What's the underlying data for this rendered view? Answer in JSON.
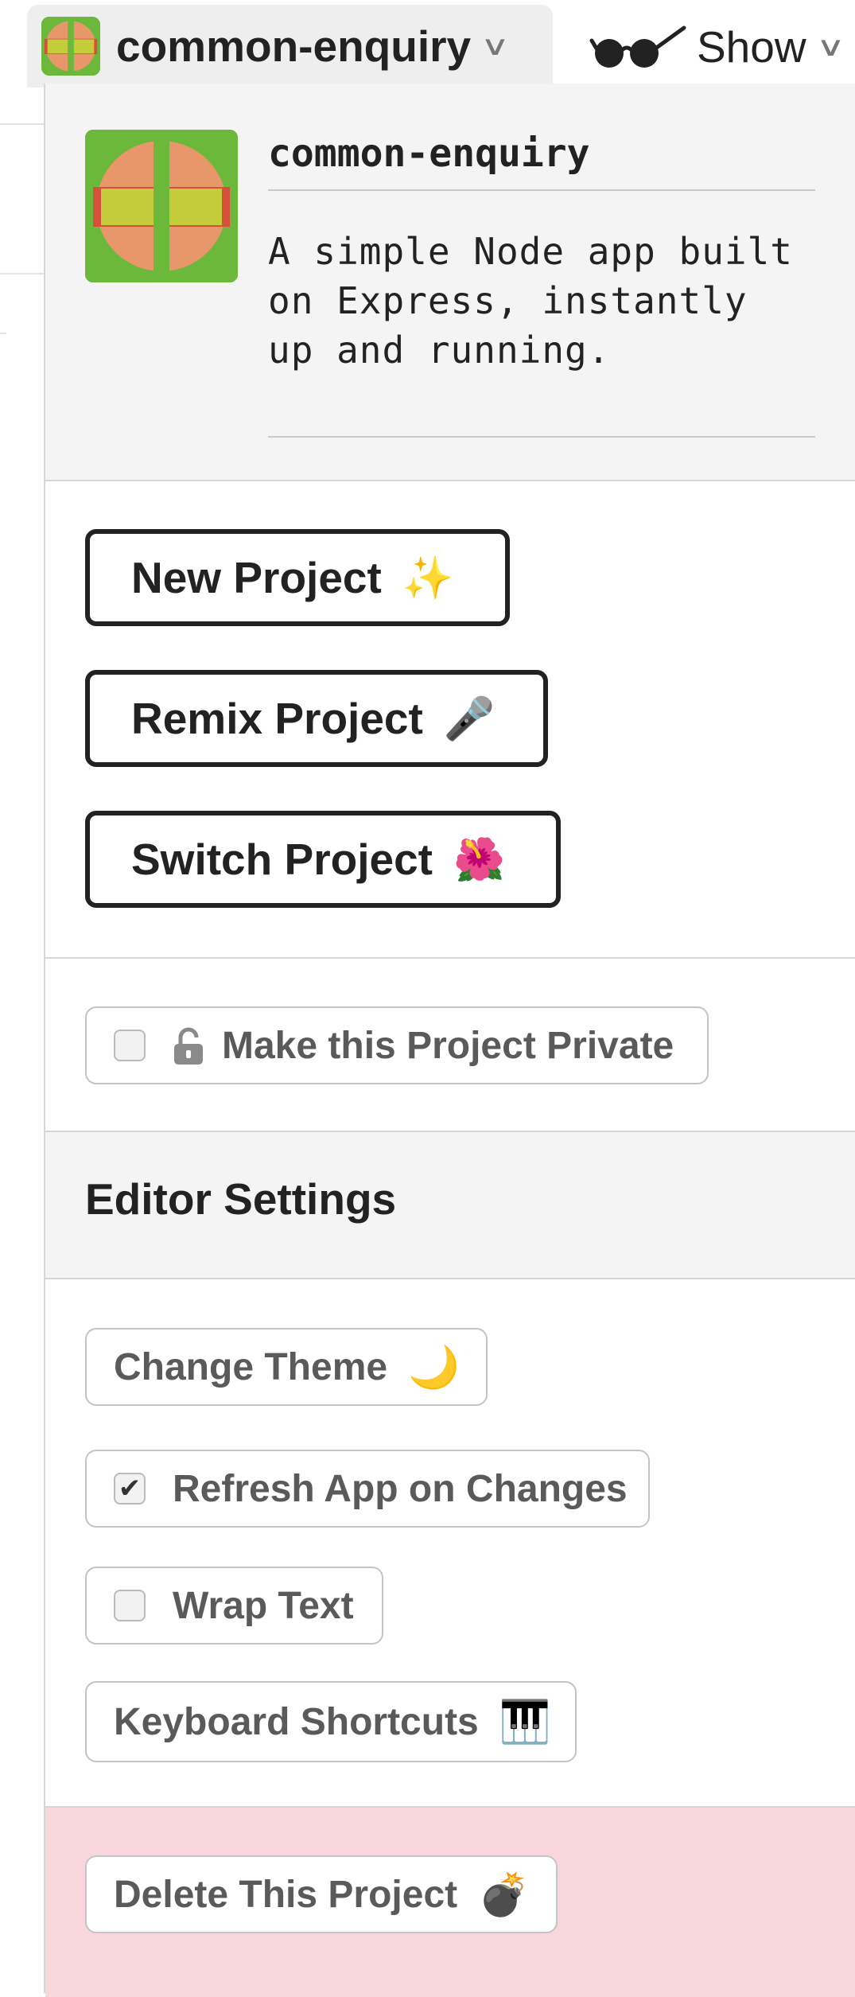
{
  "header": {
    "project_name": "common-enquiry",
    "show_label": "Show"
  },
  "project": {
    "name": "common-enquiry",
    "description": "A simple Node app built on Express, instantly up and running."
  },
  "actions": {
    "new_project": "New Project",
    "new_project_emoji": "✨",
    "remix_project": "Remix Project",
    "remix_project_emoji": "🎤",
    "switch_project": "Switch Project",
    "switch_project_emoji": "🌺"
  },
  "privacy": {
    "label": "Make this Project Private",
    "checked": false
  },
  "editor_settings": {
    "title": "Editor Settings",
    "change_theme": "Change Theme",
    "change_theme_emoji": "🌙",
    "refresh_app": "Refresh App on Changes",
    "refresh_checked": true,
    "refresh_check_mark": "✔",
    "wrap_text": "Wrap Text",
    "wrap_checked": false,
    "keyboard_shortcuts": "Keyboard Shortcuts",
    "keyboard_emoji": "🎹"
  },
  "danger": {
    "delete_project": "Delete This Project",
    "delete_emoji": "💣"
  },
  "colors": {
    "avatar_green": "#6cb83a",
    "avatar_orange": "#e8976a",
    "avatar_yellow": "#c5cc3a",
    "danger_bg": "#f9d5dc",
    "panel_bg": "#f4f4f4"
  },
  "icons": {
    "project_avatar": "project-avatar-icon",
    "glasses": "glasses-icon",
    "chevron": "chevron-down-icon",
    "lock": "lock-icon",
    "checkbox": "checkbox-icon"
  }
}
